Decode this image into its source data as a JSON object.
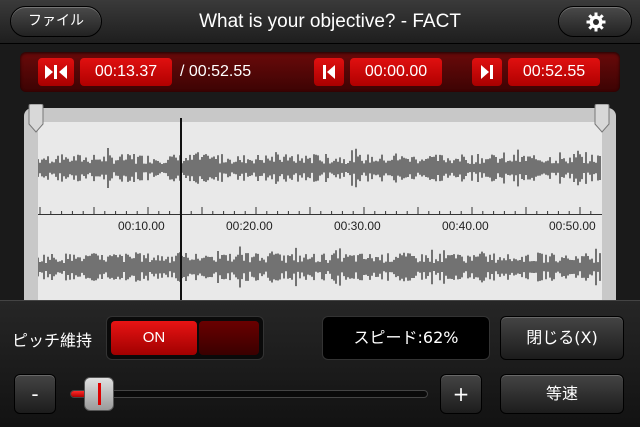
{
  "header": {
    "file_button": "ファイル",
    "title": "What is your objective? - FACT",
    "settings_icon": "gear-icon"
  },
  "transport": {
    "current_time": "00:13.37",
    "total_time": "/ 00:52.55",
    "loop_start": "00:00.00",
    "loop_end": "00:52.55",
    "play_icon": "play-pause-icon",
    "start_icon": "set-start-icon",
    "end_icon": "set-end-icon"
  },
  "waveform": {
    "tick_labels": [
      "00:10.00",
      "00:20.00",
      "00:30.00",
      "00:40.00",
      "00:50.00"
    ],
    "playhead_time": "00:13.37"
  },
  "controls": {
    "pitch_label": "ピッチ維持",
    "pitch_toggle": "ON",
    "speed_display": "スピード:62%",
    "close_button": "閉じる(X)",
    "minus_button": "-",
    "plus_button": "+",
    "normal_speed_button": "等速",
    "speed_percent": 62
  },
  "colors": {
    "accent_red": "#e01010",
    "dark_red_bar": "#4a0505",
    "waveform": "#555555"
  }
}
